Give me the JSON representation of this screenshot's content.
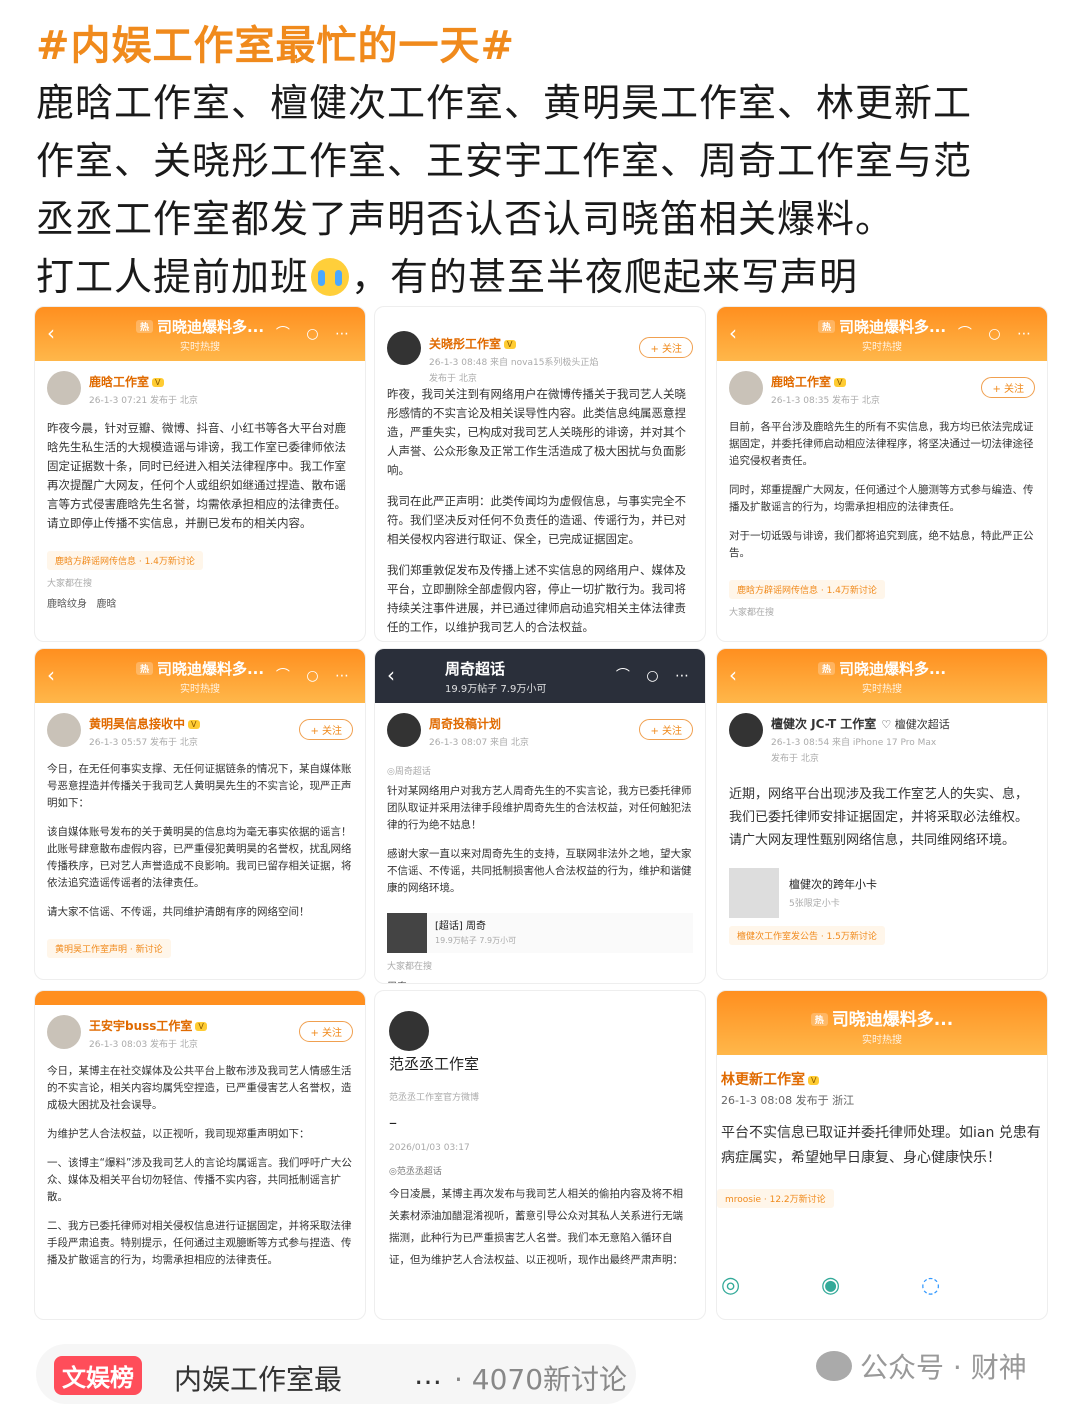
{
  "headline": {
    "hashtag": "#内娱工作室最忙的一天#",
    "line1": "鹿晗工作室、檀健次工作室、黄明昊工作室、林更新工",
    "line2": "作室、关晓彤工作室、王安宇工作室、周奇工作室与范",
    "line3": "丞丞工作室都发了声明否认否认司晓笛相关爆料。",
    "line4a": "打工人提前加班",
    "line4b": "，有的甚至半夜爬起来写声明"
  },
  "card_header": {
    "title": "司晓迪爆料多...",
    "subtitle": "实时热搜",
    "hot_tag": "热",
    "back": "‹",
    "icons": "⌒ ○ ⋯"
  },
  "cards": {
    "luhan": {
      "name": "鹿晗工作室",
      "vip": "V",
      "meta": "26-1-3 07:21  发布于 北京",
      "text": "昨夜今晨，针对豆瓣、微博、抖音、小红书等各大平台对鹿晗先生私生活的大规模造谣与诽谤，我工作室已委律师依法固定证据数十条，同时已经进入相关法律程序中。我工作室再次提醒广大网友，任何个人或组织如继通过捏造、散布谣言等方式侵害鹿晗先生名誉，均需依承担相应的法律责任。请立即停止传播不实信息，并删已发布的相关内容。",
      "topic": "鹿晗方辟谣网传信息 · 1.4万新讨论",
      "discuss": "大家都在搜",
      "tag1": "鹿晗纹身",
      "tag2": "鹿晗"
    },
    "guan": {
      "name": "关晓彤工作室",
      "vip": "V",
      "meta": "26-1-3 08:48  来自 nova15系列极头正焰",
      "location": "发布于 北京",
      "follow": "+ 关注",
      "p1": "昨夜，我司关注到有网络用户在微博传播关于我司艺人关晓彤感情的不实言论及相关误导性内容。此类信息纯属恶意捏造，严重失实，已构成对我司艺人关晓彤的诽谤，并对其个人声誉、公众形象及正常工作生活造成了极大困扰与负面影响。",
      "p2": "我司在此严正声明：此类传闻均为虚假信息，与事实完全不符。我们坚决反对任何不负责任的造谣、传谣行为，并已对相关侵权内容进行取证、保全，已完成证据固定。",
      "p3": "我们郑重敦促发布及传播上述不实信息的网络用户、媒体及平台，立即删除全部虚假内容，停止一切扩散行为。我司将持续关注事件进展，并已通过律师启动追究相关主体法律责任的工作，以维护我司艺人的合法权益。"
    },
    "lgx": {
      "name": "鹿晗工作室",
      "vip": "V",
      "meta": "26-1-3 08:35  发布于 北京",
      "follow": "+ 关注",
      "p1": "目前，各平台涉及鹿晗先生的所有不实信息，我方均已依法完成证据固定，并委托律师启动相应法律程序，将坚决通过一切法律途径追究侵权者责任。",
      "p2": "同时，郑重提醒广大网友，任何通过个人臆测等方式参与编造、传播及扩散谣言的行为，均需承担相应的法律责任。",
      "p3": "对于一切诋毁与诽谤，我们都将追究到底，绝不姑息，特此严正公告。",
      "topic": "鹿晗方辟谣网传信息 · 1.4万新讨论",
      "discuss": "大家都在搜"
    },
    "huang": {
      "name": "黄明昊信息接收中",
      "vip": "V",
      "meta": "26-1-3 05:57  发布于 北京",
      "follow": "+ 关注",
      "p1": "今日，在无任何事实支撑、无任何证据链条的情况下，某自媒体账号恶意捏造并传播关于我司艺人黄明昊先生的不实言论，现严正声明如下：",
      "p2": "该自媒体账号发布的关于黄明昊的信息均为毫无事实依据的谣言！此账号肆意散布虚假内容，已严重侵犯黄明昊的名誉权，扰乱网络传播秩序，已对艺人声誉造成不良影响。我司已留存相关证据，将依法追究造谣传谣者的法律责任。",
      "p3": "请大家不信谣、不传谣，共同维护清朗有序的网络空间！",
      "topic": "黄明昊工作室声明 · 新讨论"
    },
    "zhou": {
      "bar_title": "周奇超话",
      "bar_sub": "19.9万帖子 7.9万小可",
      "name": "周奇投稿计划",
      "meta": "26-1-3 08:07  来自 北京",
      "follow": "+ 关注",
      "tag": "◎周奇超话",
      "p1": "针对某网络用户对我方艺人周奇先生的不实言论，我方已委托律师团队取证并采用法律手段维护周奇先生的合法权益，对任何触犯法律的行为绝不姑息！",
      "p2": "感谢大家一直以来对周奇先生的支持，互联网非法外之地，望大家不信谣、不传谣，共同抵制损害他人合法权益的行为，维护和谐健康的网络环境。",
      "embed_title": "[超话] 周奇",
      "embed_sub": "19.9万帖子 7.9万小可",
      "discuss": "大家都在搜",
      "tag1": "周奇"
    },
    "tan": {
      "name": "檀健次 JC-T 工作室",
      "extra": "♡ 檀健次超话",
      "meta": "26-1-3 08:54  来自 iPhone 17 Pro Max",
      "location": "发布于 北京",
      "text": "近期，网络平台出现涉及我工作室艺人的失实、息，我们已委托律师安排证据固定，并将采取必法维权。请广大网友理性甄别网络信息，共同维网络环境。",
      "embed_title": "檀健次的跨年小卡",
      "embed_sub": "5张限定小卡",
      "topic": "檀健次工作室发公告 · 1.5万新讨论"
    },
    "wang": {
      "name": "王安宇buss工作室",
      "vip": "V",
      "meta": "26-1-3 08:03  发布于 北京",
      "follow": "+ 关注",
      "p1": "今日，某博主在社交媒体及公共平台上散布涉及我司艺人情感生活的不实言论，相关内容均属凭空捏造，已严重侵害艺人名誉权，造成极大困扰及社会误导。",
      "p2": "为维护艺人合法权益，以正视听，我司现郑重声明如下：",
      "p3": "一、该博主“爆料”涉及我司艺人的言论均属谣言。我们呼吁广大公众、媒体及相关平台切勿轻信、传播不实内容，共同抵制谣言扩散。",
      "p4": "二、我方已委托律师对相关侵权信息进行证据固定，并将采取法律手段严肃追责。特别提示，任何通过主观臆断等方式参与捏造、传播及扩散谣言的行为，均需承担相应的法律责任。"
    },
    "fan": {
      "name": "范丞丞工作室",
      "sub": "范丞丞工作室官方微博",
      "dash": "–",
      "date": "2026/01/03 03:17",
      "tag": "◎范丞丞超话",
      "text": "今日凌晨，某博主再次发布与我司艺人相关的偷拍内容及将不相关素材添油加醋混淆视听，蓄意引导公众对其私人关系进行无端揣测，此种行为已严重损害艺人名誉。我们本无意陷入循环自证，但为维护艺人合法权益、以正视听，现作出最终严肃声明："
    },
    "lin": {
      "name": "林更新工作室",
      "vip": "V",
      "meta": "26-1-3 08:08  发布于 浙江",
      "text": "平台不实信息已取证并委托律师处理。如ian 兑患有病症属实，希望她早日康复、身心健康快乐！",
      "topic": "mroosie · 12.2万新讨论"
    }
  },
  "footer": {
    "badge": "文娱榜",
    "topic": "内娱工作室最",
    "dots": "…",
    "count": "· 4070新讨论",
    "wechat": "公众号 · 财神"
  },
  "colors": {
    "accent": "#f08a1c",
    "header": "#ff8f1f",
    "badge": "#ff4d5a"
  }
}
